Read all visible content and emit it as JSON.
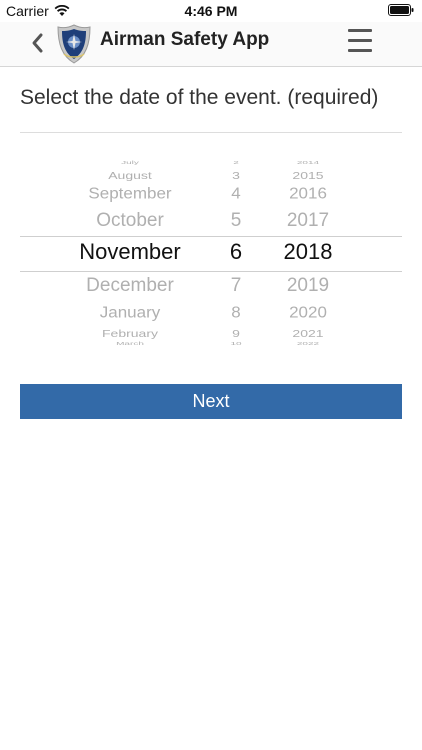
{
  "status_bar": {
    "carrier": "Carrier",
    "time": "4:46 PM"
  },
  "nav": {
    "title": "Airman Safety App",
    "back_icon": "chevron-left-icon",
    "logo": "air-force-shield-logo",
    "menu_icon": "hamburger-menu-icon"
  },
  "prompt": "Select the date of the event. (required)",
  "picker": {
    "months": [
      "July",
      "August",
      "September",
      "October",
      "November",
      "December",
      "January",
      "February",
      "March"
    ],
    "days": [
      "2",
      "3",
      "4",
      "5",
      "6",
      "7",
      "8",
      "9",
      "10"
    ],
    "years": [
      "2014",
      "2015",
      "2016",
      "2017",
      "2018",
      "2019",
      "2020",
      "2021",
      "2022"
    ],
    "selected": {
      "month": "November",
      "day": "6",
      "year": "2018"
    }
  },
  "next_label": "Next",
  "colors": {
    "accent": "#336aa8",
    "selected_text": "#111111",
    "faded_text": "#b0b0b0"
  }
}
